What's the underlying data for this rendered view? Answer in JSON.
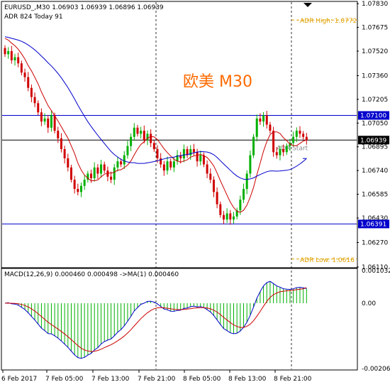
{
  "header": {
    "title": "EURUSD_,M30  1.06903 1.06939 1.06896 1.06939",
    "adr": "ADR 824  Today 91"
  },
  "watermark": "欧美 M30",
  "colors": {
    "bull": "#00b000",
    "bear": "#d00000",
    "ma_fast": "#cc0000",
    "ma_slow": "#0000cc",
    "level": "#0000cc",
    "adr": "#e0a000",
    "macd_hist": "#00b000",
    "watermark": "#ff6a00"
  },
  "chart_data": [
    {
      "type": "candlestick",
      "symbol": "EURUSD_",
      "timeframe": "M30",
      "ylim": [
        1.0611,
        1.0784
      ],
      "y_ticks": [
        "1.07830",
        "1.07675",
        "1.07520",
        "1.07360",
        "1.07205",
        "1.07050",
        "1.06895",
        "1.06740",
        "1.06585",
        "1.06430",
        "1.06270",
        "1.06110"
      ],
      "x_ticks": [
        "6 Feb 2017",
        "7 Feb 05:00",
        "7 Feb 13:00",
        "7 Feb 21:00",
        "8 Feb 05:00",
        "8 Feb 13:00",
        "8 Feb 21:00"
      ],
      "price_labels": [
        {
          "name": "last",
          "text": "1.06939",
          "value": 1.06939
        },
        {
          "name": "upper_level",
          "text": "1.07100",
          "value": 1.071
        },
        {
          "name": "lower_level",
          "text": "1.06391",
          "value": 1.06391
        }
      ],
      "adr_high": {
        "text": "ADR High: 1.0772",
        "value": 1.07723
      },
      "adr_low": {
        "text": "ADR Low: 1.0616",
        "value": 1.06162
      },
      "adr_start_label": "ADR Start",
      "close": [
        1.075,
        1.0752,
        1.0746,
        1.0748,
        1.0744,
        1.0738,
        1.0735,
        1.0728,
        1.0722,
        1.0718,
        1.0712,
        1.0706,
        1.0708,
        1.0702,
        1.071,
        1.07,
        1.0695,
        1.0688,
        1.0682,
        1.0676,
        1.0668,
        1.0662,
        1.066,
        1.0664,
        1.0668,
        1.0672,
        1.0669,
        1.0676,
        1.0672,
        1.0678,
        1.0674,
        1.067,
        1.0668,
        1.0676,
        1.068,
        1.0678,
        1.0684,
        1.069,
        1.0696,
        1.0702,
        1.0698,
        1.07,
        1.0694,
        1.0698,
        1.0692,
        1.0688,
        1.0682,
        1.0678,
        1.0674,
        1.068,
        1.0676,
        1.068,
        1.0684,
        1.0682,
        1.0688,
        1.0684,
        1.0688,
        1.0686,
        1.068,
        1.0684,
        1.0678,
        1.0672,
        1.0668,
        1.066,
        1.0652,
        1.0645,
        1.0642,
        1.0646,
        1.0642,
        1.0644,
        1.0648,
        1.0655,
        1.0662,
        1.0672,
        1.0684,
        1.0696,
        1.0708,
        1.0706,
        1.071,
        1.0704,
        1.07,
        1.0686,
        1.0684,
        1.0688,
        1.0686,
        1.069,
        1.0692,
        1.0696,
        1.07,
        1.0698,
        1.0696,
        1.06939
      ]
    },
    {
      "type": "macd",
      "title": "MACD(12,26,9) 0.000460 0.000498  ->MA(1) 0.000460",
      "ylim": [
        -0.00206,
        0.00103
      ],
      "y_ticks": [
        "0.001032",
        "0.00",
        "-0.00206"
      ],
      "macd_last": 0.00046,
      "signal_last": 0.000498
    }
  ]
}
